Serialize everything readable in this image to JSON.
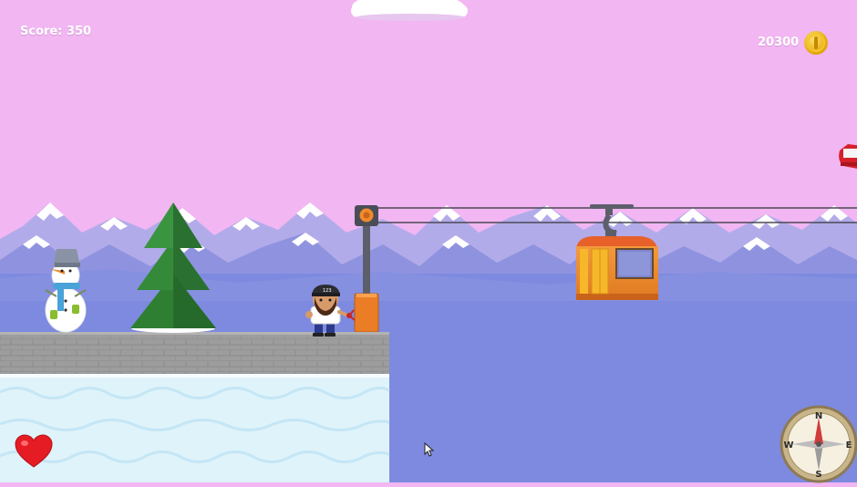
{
  "hud": {
    "score_label": "Score:",
    "score_value": "350",
    "coins": "20300"
  },
  "compass": {
    "n": "N",
    "s": "S",
    "e": "E",
    "w": "W"
  },
  "colors": {
    "sky": "#f2b6f2",
    "mountain_far": "#a9a6e6",
    "mountain_near": "#7c83d8",
    "valley": "#7e8adf",
    "snow": "#ffffff",
    "stone": "#9c9c9c",
    "ice": "#dff3fb",
    "tree": "#2e7d32",
    "cable_car": "#f08a2c",
    "coin": "#f5c518",
    "heart": "#e51c23"
  },
  "icons": {
    "coin": "coin-icon",
    "life": "heart-icon",
    "navigation": "compass-icon",
    "pointer": "mouse-cursor-icon"
  }
}
